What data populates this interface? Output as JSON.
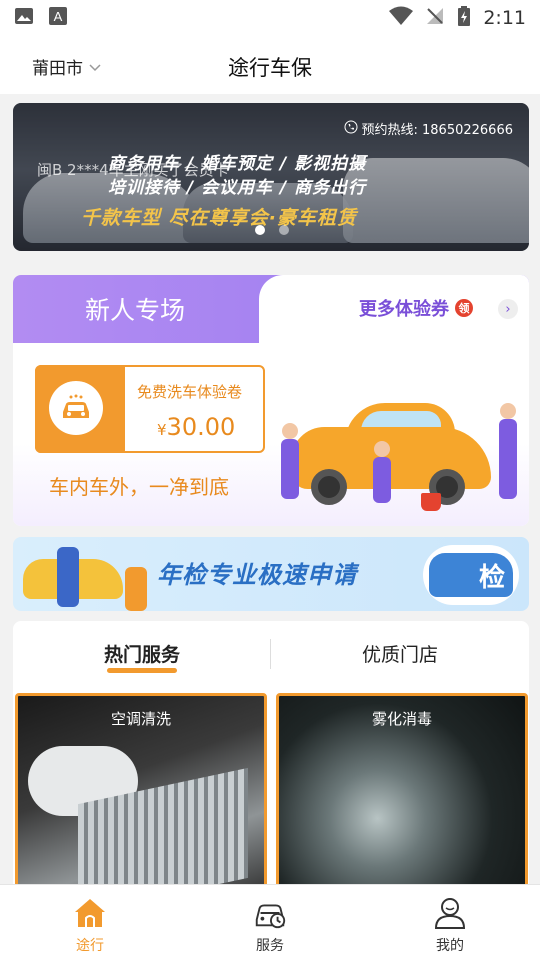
{
  "status_bar": {
    "time": "2:11"
  },
  "header": {
    "city": "莆田市",
    "title": "途行车保"
  },
  "banner": {
    "hotline": "预约热线: 18650226666",
    "plate": "闽B 2***4车主刚买了会员卡",
    "line1": "商务用车 / 婚车预定 / 影视拍摄",
    "line2": "培训接待 / 会议用车 / 商务出行",
    "slogan": "千款车型 尽在尊享会·豪车租赁"
  },
  "new_user": {
    "title": "新人专场",
    "more": "更多体验券",
    "badge": "领",
    "coupon_name": "免费洗车体验卷",
    "coupon_currency": "¥",
    "coupon_price": "30.00",
    "slogan": "车内车外，一净到底"
  },
  "inspection": {
    "text": "年检专业极速申请",
    "badge": "检"
  },
  "services": {
    "tabs": [
      {
        "label": "热门服务",
        "active": true
      },
      {
        "label": "优质门店",
        "active": false
      }
    ],
    "cards": [
      {
        "label": "空调清洗"
      },
      {
        "label": "雾化消毒"
      }
    ]
  },
  "bottom_nav": [
    {
      "label": "途行",
      "icon": "home-icon",
      "active": true
    },
    {
      "label": "服务",
      "icon": "car-service-icon",
      "active": false
    },
    {
      "label": "我的",
      "icon": "user-icon",
      "active": false
    }
  ],
  "colors": {
    "accent": "#f29a2e",
    "purple": "#9a7bf0",
    "blue": "#2a6fc4"
  }
}
